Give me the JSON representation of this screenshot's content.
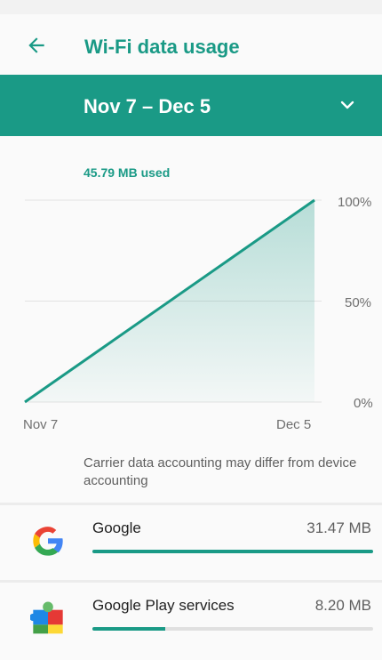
{
  "header": {
    "title": "Wi-Fi data usage"
  },
  "cycle": {
    "label": "Nov 7 – Dec 5"
  },
  "usage": {
    "used_label": "45.79 MB used"
  },
  "chart_data": {
    "type": "area",
    "x": [
      "Nov 7",
      "Dec 5"
    ],
    "y": [
      0,
      100
    ],
    "y_unit": "%",
    "ylim": [
      0,
      100
    ],
    "y_ticks": [
      "100%",
      "50%",
      "0%"
    ],
    "x_ticks": [
      "Nov 7",
      "Dec 5"
    ],
    "grid": true,
    "line_color": "#1a9a86"
  },
  "note": "Carrier data accounting may differ from device accounting",
  "apps": [
    {
      "name": "Google",
      "size": "31.47 MB",
      "fraction": 1.0,
      "icon": "google-icon"
    },
    {
      "name": "Google Play services",
      "size": "8.20 MB",
      "fraction": 0.26,
      "icon": "google-play-services-icon"
    }
  ],
  "colors": {
    "accent": "#1a9a86",
    "track": "#e0e0e0"
  }
}
